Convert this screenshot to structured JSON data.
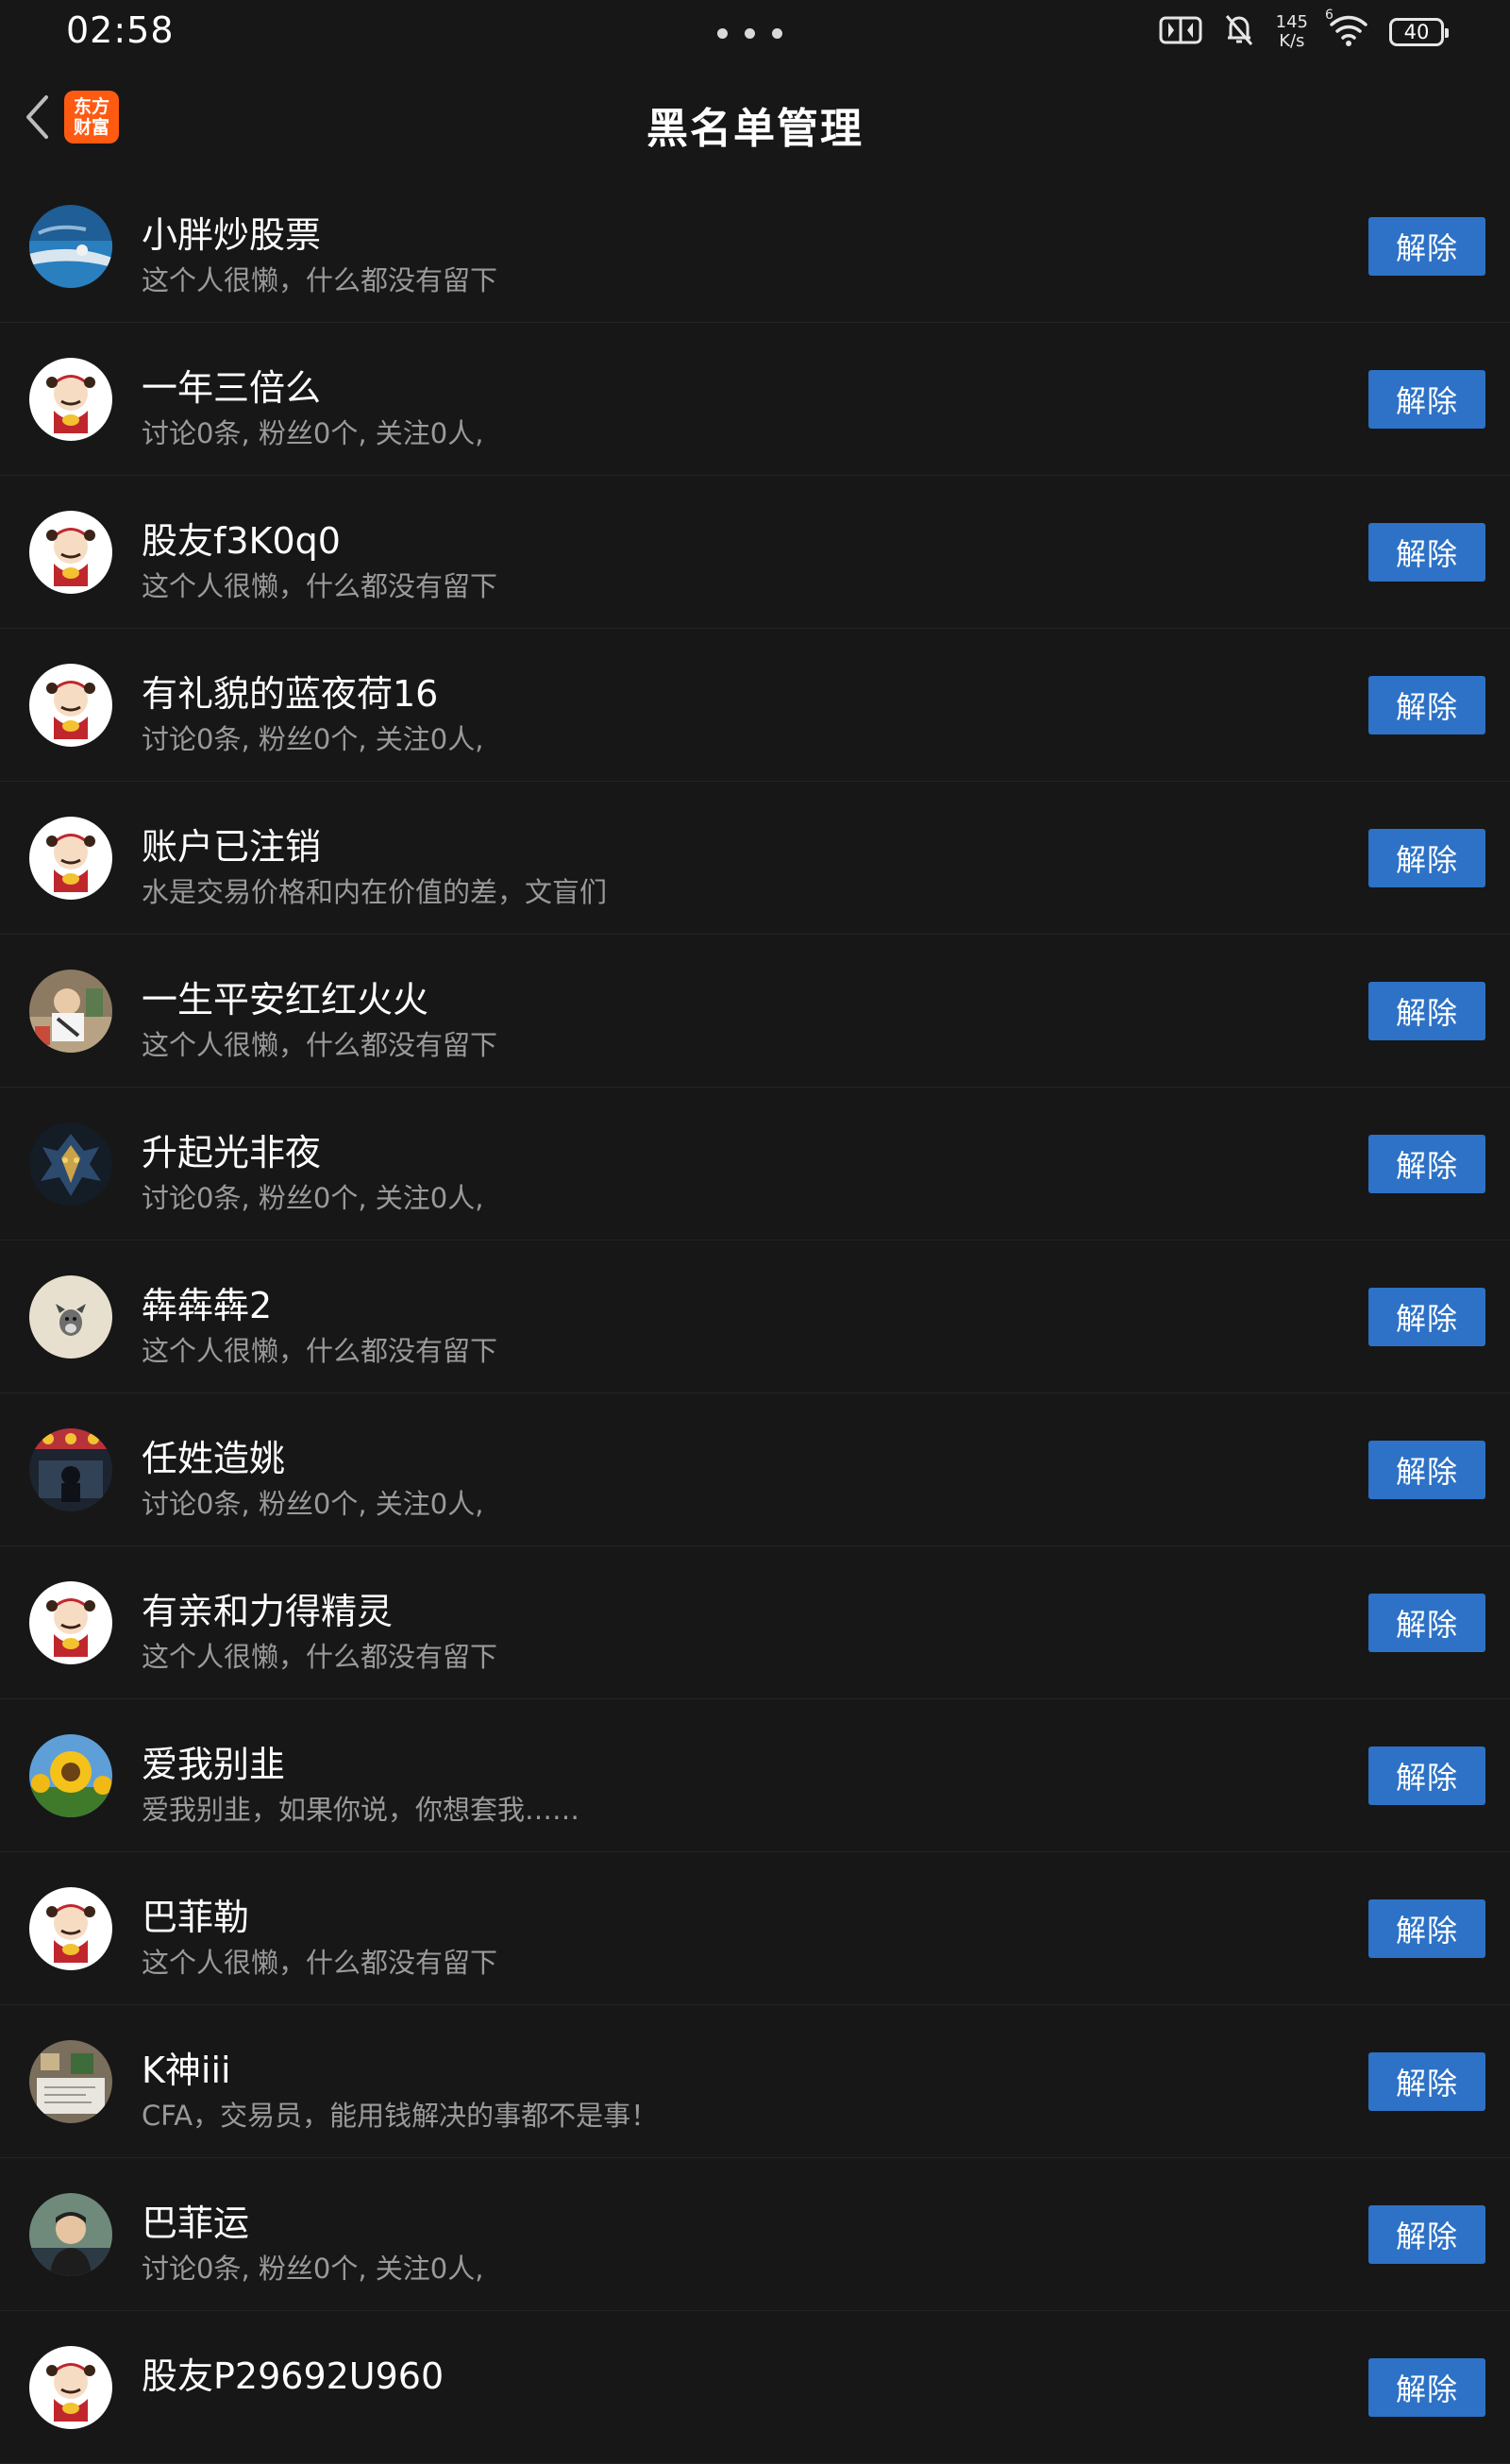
{
  "status_bar": {
    "time": "02:58",
    "net_speed_value": "145",
    "net_speed_unit": "K/s",
    "wifi_label": "6",
    "battery": "40"
  },
  "header": {
    "title": "黑名单管理",
    "logo_line1": "东方",
    "logo_line2": "财富"
  },
  "list": {
    "remove_label": "解除",
    "items": [
      {
        "name": "小胖炒股票",
        "desc": "这个人很懒，什么都没有留下",
        "avatar": "ocean"
      },
      {
        "name": "一年三倍么",
        "desc": "讨论0条, 粉丝0个, 关注0人,",
        "avatar": "mascot"
      },
      {
        "name": "股友f3K0q0",
        "desc": "这个人很懒，什么都没有留下",
        "avatar": "mascot"
      },
      {
        "name": "有礼貌的蓝夜荷16",
        "desc": "讨论0条, 粉丝0个, 关注0人,",
        "avatar": "mascot"
      },
      {
        "name": "账户已注销",
        "desc": "水是交易价格和内在价值的差，文盲们",
        "avatar": "mascot"
      },
      {
        "name": "一生平安红红火火",
        "desc": "这个人很懒，什么都没有留下",
        "avatar": "photo"
      },
      {
        "name": "升起光非夜",
        "desc": "讨论0条, 粉丝0个, 关注0人,",
        "avatar": "dragon"
      },
      {
        "name": "犇犇犇2",
        "desc": "这个人很懒，什么都没有留下",
        "avatar": "dog"
      },
      {
        "name": "任姓造姚",
        "desc": "讨论0条, 粉丝0个, 关注0人,",
        "avatar": "night"
      },
      {
        "name": "有亲和力得精灵",
        "desc": "这个人很懒，什么都没有留下",
        "avatar": "mascot"
      },
      {
        "name": "爱我别韭",
        "desc": "爱我别韭，如果你说，你想套我……",
        "avatar": "sunflower"
      },
      {
        "name": "巴菲勒",
        "desc": "这个人很懒，什么都没有留下",
        "avatar": "mascot"
      },
      {
        "name": "K神iii",
        "desc": "CFA，交易员，能用钱解决的事都不是事！",
        "avatar": "desk"
      },
      {
        "name": "巴菲运",
        "desc": "讨论0条, 粉丝0个, 关注0人,",
        "avatar": "man"
      },
      {
        "name": "股友P29692U960",
        "desc": "",
        "avatar": "mascot"
      }
    ]
  }
}
